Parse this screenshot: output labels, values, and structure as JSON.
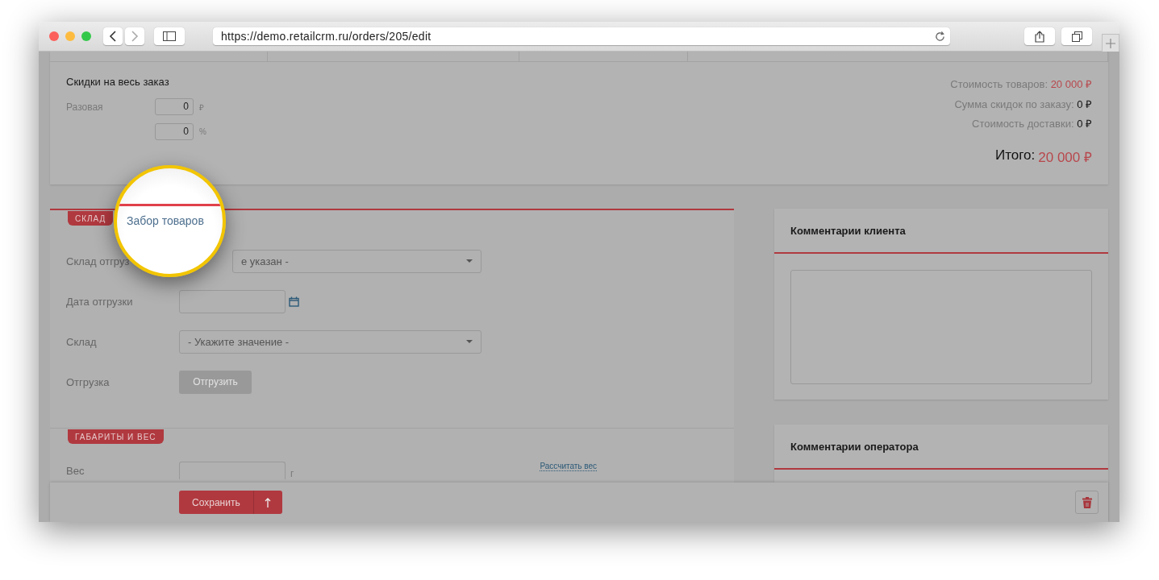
{
  "browser": {
    "url": "https://demo.retailcrm.ru/orders/205/edit"
  },
  "discounts": {
    "title": "Скидки на весь заказ",
    "rows": [
      {
        "label": "Разовая",
        "value": "0",
        "unit": "₽"
      },
      {
        "value": "0",
        "unit": "%"
      }
    ]
  },
  "totals": {
    "lines": [
      {
        "label": "Стоимость товаров:",
        "value": "20 000 ₽",
        "highlight": true
      },
      {
        "label": "Сумма скидок по заказу:",
        "value": "0 ₽",
        "highlight": false
      },
      {
        "label": "Стоимость доставки:",
        "value": "0 ₽",
        "highlight": false
      }
    ],
    "total": {
      "label": "Итого:",
      "value": "20 000 ₽"
    }
  },
  "warehouse_section": {
    "tabs": [
      {
        "label": "СКЛАД",
        "selected": true
      },
      {
        "label": "Забор товаров",
        "selected": false
      }
    ],
    "fields": [
      {
        "kind": "select",
        "label": "Склад отгруз",
        "value": "е указан -"
      },
      {
        "kind": "date",
        "label": "Дата отгрузки"
      },
      {
        "kind": "select",
        "label": "Склад",
        "value": "- Укажите значение -"
      },
      {
        "kind": "button",
        "label": "Отгрузка",
        "button": "Отгрузить",
        "disabled": true
      }
    ]
  },
  "dimensions_section": {
    "tag": "ГАБАРИТЫ И ВЕС",
    "weight": {
      "label": "Вес",
      "unit": "г"
    },
    "link": "Рассчитать вес"
  },
  "comment_cards": [
    {
      "title": "Комментарии клиента"
    },
    {
      "title": "Комментарии оператора"
    }
  ],
  "footer": {
    "save": "Сохранить"
  }
}
